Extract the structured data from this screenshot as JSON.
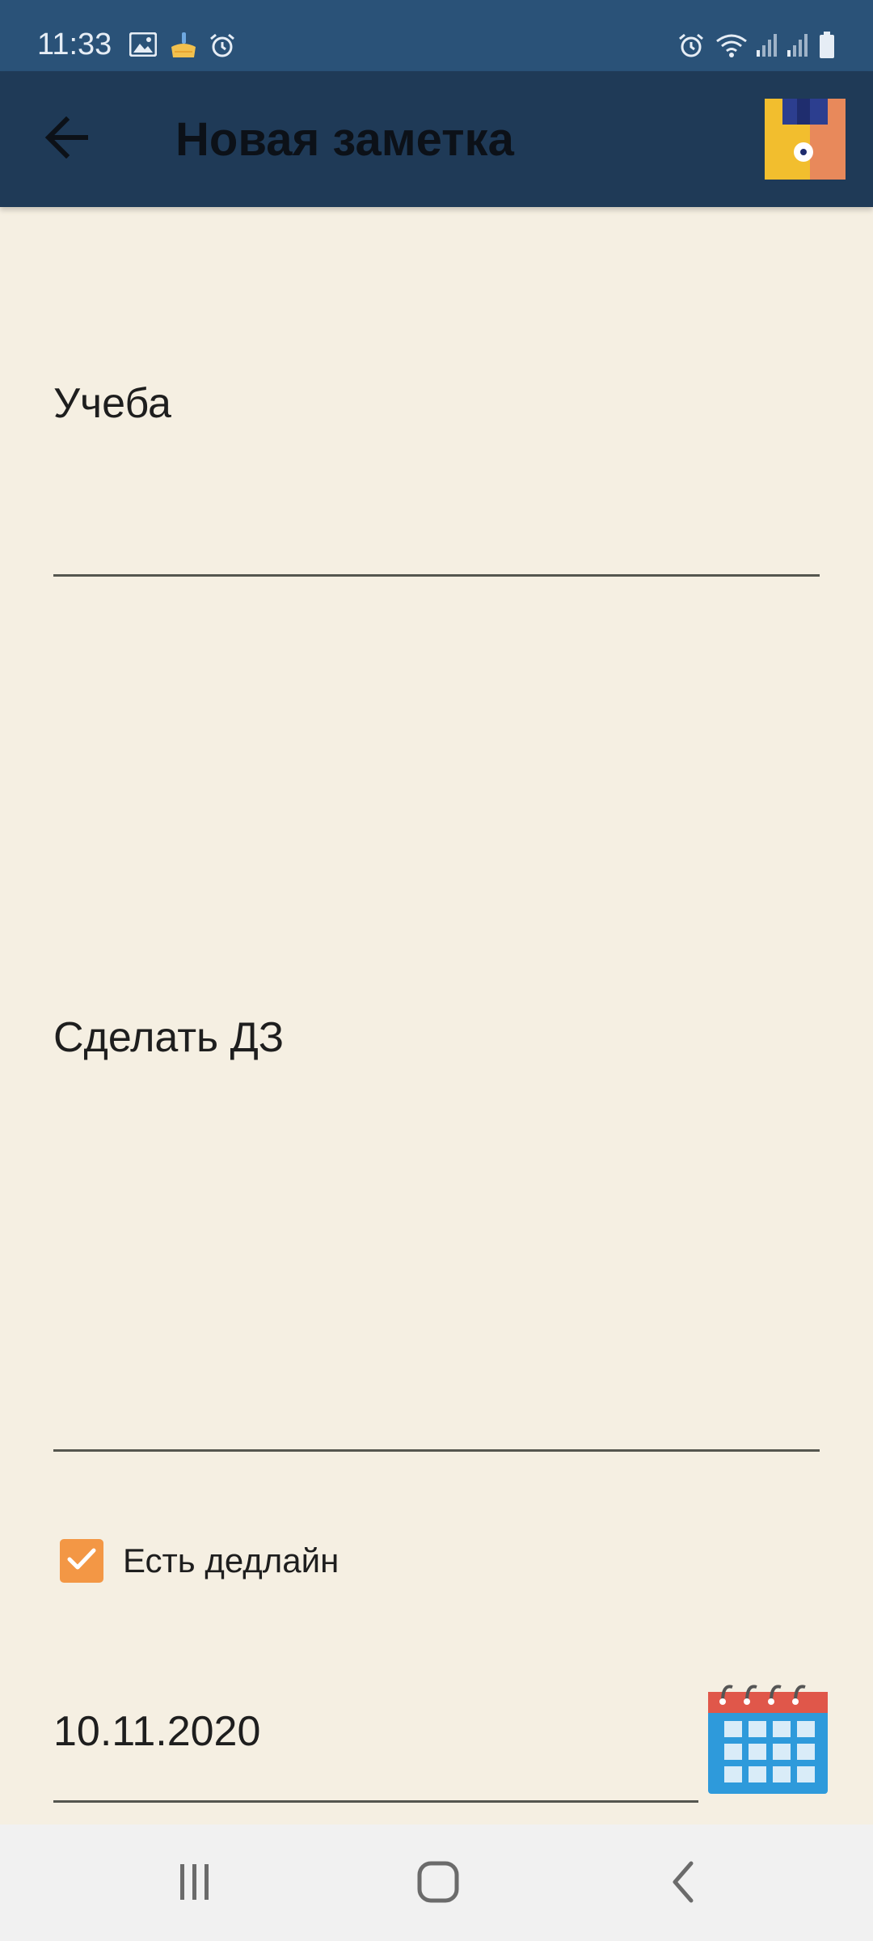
{
  "status_bar": {
    "time": "11:33",
    "left_icons": [
      "image-icon",
      "cleaner-icon",
      "alarm-icon"
    ],
    "right_icons": [
      "alarm-icon",
      "wifi-icon",
      "signal-icon",
      "signal-icon",
      "battery-icon"
    ],
    "background": "#2A5278"
  },
  "app_bar": {
    "title": "Новая заметка",
    "back_icon": "arrow-back-icon",
    "save_icon": "floppy-disk-icon",
    "background": "#1F3A57"
  },
  "form": {
    "title_value": "Учеба",
    "body_value": "Сделать ДЗ",
    "deadline_checkbox": {
      "label": "Есть дедлайн",
      "checked": true,
      "color": "#F39745"
    },
    "deadline_date": "10.11.2020",
    "calendar_icon": "calendar-icon"
  },
  "colors": {
    "page_background": "#F5EFE2",
    "nav_background": "#F1F1F1"
  },
  "nav_bar": {
    "icons": [
      "recent-apps-icon",
      "home-icon",
      "back-icon"
    ]
  }
}
